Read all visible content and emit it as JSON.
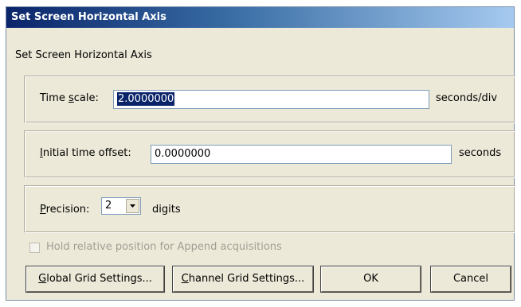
{
  "dialog": {
    "title": "Set Screen Horizontal Axis",
    "subtitle": "Set Screen Horizontal Axis"
  },
  "time_scale": {
    "label_prefix": "Time ",
    "label_accel": "s",
    "label_suffix": "cale:",
    "value": "2.0000000",
    "unit": "seconds/div"
  },
  "initial_offset": {
    "label_accel": "I",
    "label_suffix": "nitial time offset:",
    "value": "0.0000000",
    "unit": "seconds"
  },
  "precision": {
    "label_accel": "P",
    "label_suffix": "recision:",
    "value": "2",
    "unit": "digits"
  },
  "hold_checkbox": {
    "label": "Hold relative position for Append acquisitions",
    "checked": false,
    "enabled": false
  },
  "buttons": {
    "global_accel": "G",
    "global_suffix": "lobal Grid Settings...",
    "channel_accel": "C",
    "channel_suffix": "hannel Grid Settings...",
    "ok": "OK",
    "cancel": "Cancel"
  },
  "icons": {
    "combo_arrow": "chevron-down-icon"
  }
}
